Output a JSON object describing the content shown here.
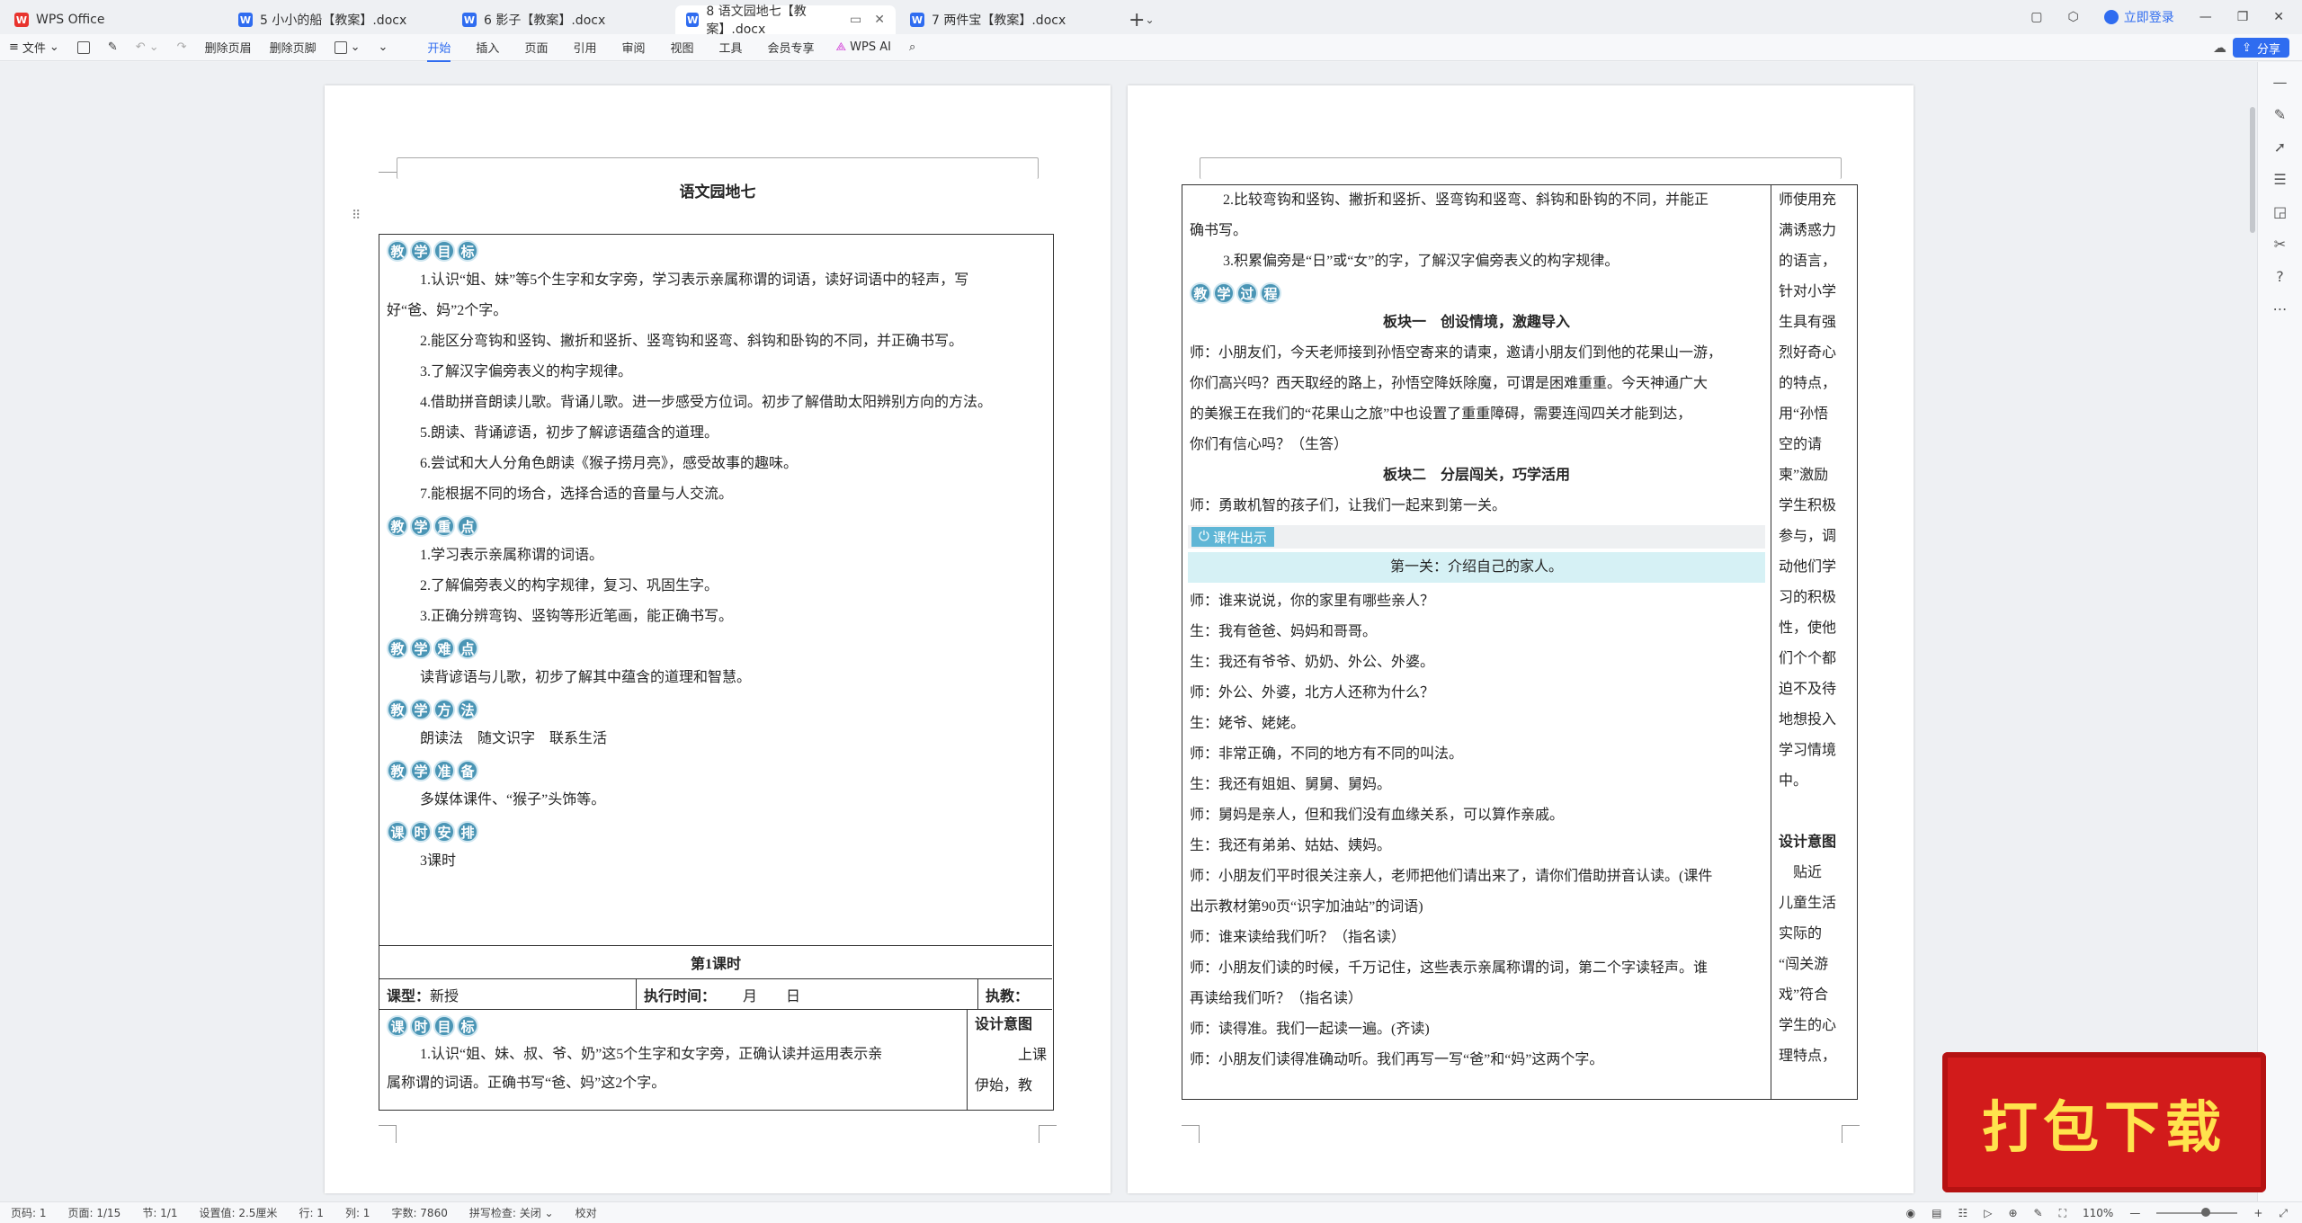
{
  "tabs": [
    {
      "label": "WPS Office",
      "type": "wps"
    },
    {
      "label": "5 小小的船【教案】.docx",
      "type": "doc"
    },
    {
      "label": "6 影子【教案】.docx",
      "type": "doc"
    },
    {
      "label": "8 语文园地七【教案】.docx",
      "type": "doc",
      "active": true
    },
    {
      "label": "7 两件宝【教案】.docx",
      "type": "doc"
    }
  ],
  "window": {
    "login": "立即登录",
    "share": "分享"
  },
  "ribbon": {
    "file": "文件",
    "delete_header": "删除页眉",
    "delete_footer": "删除页脚",
    "menus": [
      "开始",
      "插入",
      "页面",
      "引用",
      "审阅",
      "视图",
      "工具",
      "会员专享"
    ],
    "wps_ai": "WPS AI"
  },
  "page1": {
    "title": "语文园地七",
    "sections": [
      {
        "badge": [
          "教",
          "学",
          "目",
          "标"
        ],
        "lines": [
          "1.认识“姐、妹”等5个生字和女字旁，学习表示亲属称谓的词语，读好词语中的轻声，写",
          "好“爸、妈”2个字。",
          "2.能区分弯钩和竖钩、撇折和竖折、竖弯钩和竖弯、斜钩和卧钩的不同，并正确书写。",
          "3.了解汉字偏旁表义的构字规律。",
          "4.借助拼音朗读儿歌。背诵儿歌。进一步感受方位词。初步了解借助太阳辨别方向的方法。",
          "5.朗读、背诵谚语，初步了解谚语蕴含的道理。",
          "6.尝试和大人分角色朗读《猴子捞月亮》，感受故事的趣味。",
          "7.能根据不同的场合，选择合适的音量与人交流。"
        ]
      },
      {
        "badge": [
          "教",
          "学",
          "重",
          "点"
        ],
        "lines": [
          "1.学习表示亲属称谓的词语。",
          "2.了解偏旁表义的构字规律，复习、巩固生字。",
          "3.正确分辨弯钩、竖钩等形近笔画，能正确书写。"
        ]
      },
      {
        "badge": [
          "教",
          "学",
          "难",
          "点"
        ],
        "lines": [
          "读背谚语与儿歌，初步了解其中蕴含的道理和智慧。"
        ]
      },
      {
        "badge": [
          "教",
          "学",
          "方",
          "法"
        ],
        "lines": [
          "朗读法　随文识字　联系生活"
        ]
      },
      {
        "badge": [
          "教",
          "学",
          "准",
          "备"
        ],
        "lines": [
          "多媒体课件、“猴子”头饰等。"
        ]
      },
      {
        "badge": [
          "课",
          "时",
          "安",
          "排"
        ],
        "lines": [
          "3课时"
        ]
      }
    ],
    "lesson_title": "第1课时",
    "type_label": "课型：",
    "type_value": "新授",
    "time_label": "执行时间：",
    "time_value": "月　　日",
    "teacher_label": "执教：",
    "lesson_badge": [
      "课",
      "时",
      "目",
      "标"
    ],
    "lesson_goal": [
      "1.认识“姐、妹、叔、爷、奶”这5个生字和女字旁，正确认读并运用表示亲",
      "属称谓的词语。正确书写“爸、妈”这2个字。"
    ],
    "design_title": "设计意图",
    "design_lines": [
      "上课",
      "伊始，教"
    ]
  },
  "page2": {
    "main_lines": [
      "2.比较弯钩和竖钩、撇折和竖折、竖弯钩和竖弯、斜钩和卧钩的不同，并能正",
      "确书写。",
      "3.积累偏旁是“日”或“女”的字，了解汉字偏旁表义的构字规律。"
    ],
    "process_badge": [
      "教",
      "学",
      "过",
      "程"
    ],
    "block1_title": "板块一　创设情境，激趣导入",
    "block1_lines": [
      "师：小朋友们，今天老师接到孙悟空寄来的请柬，邀请小朋友们到他的花果山一游，",
      "你们高兴吗？西天取经的路上，孙悟空降妖除魔，可谓是困难重重。今天神通广大",
      "的美猴王在我们的“花果山之旅”中也设置了重重障碍，需要连闯四关才能到达，",
      "你们有信心吗？（生答）"
    ],
    "block2_title": "板块二　分层闯关，巧学活用",
    "block2_intro": "师：勇敢机智的孩子们，让我们一起来到第一关。",
    "courseware": "课件出示",
    "first_level": "第一关：介绍自己的家人。",
    "dialog": [
      "师：谁来说说，你的家里有哪些亲人？",
      "生：我有爸爸、妈妈和哥哥。",
      "生：我还有爷爷、奶奶、外公、外婆。",
      "师：外公、外婆，北方人还称为什么？",
      "生：姥爷、姥姥。",
      "师：非常正确，不同的地方有不同的叫法。",
      "生：我还有姐姐、舅舅、舅妈。",
      "师：舅妈是亲人，但和我们没有血缘关系，可以算作亲戚。",
      "生：我还有弟弟、姑姑、姨妈。",
      "师：小朋友们平时很关注亲人，老师把他们请出来了，请你们借助拼音认读。(课件",
      "出示教材第90页“识字加油站”的词语)",
      "师：谁来读给我们听？（指名读）",
      "师：小朋友们读的时候，千万记住，这些表示亲属称谓的词，第二个字读轻声。谁",
      "再读给我们听？（指名读）",
      "师：读得准。我们一起读一遍。(齐读)",
      "师：小朋友们读得准确动听。我们再写一写“爸”和“妈”这两个字。"
    ],
    "side_lines": [
      "师使用充",
      "满诱惑力",
      "的语言，",
      "针对小学",
      "生具有强",
      "烈好奇心",
      "的特点，",
      "用“孙悟",
      "空的请",
      "柬”激励",
      "学生积极",
      "参与，调",
      "动他们学",
      "习的积极",
      "性，使他",
      "们个个都",
      "迫不及待",
      "地想投入",
      "学习情境",
      "中。"
    ],
    "side_design_title": "设计意图",
    "side_design_lines": [
      "　贴近",
      "儿童生活",
      "实际的",
      "“闯关游",
      "戏”符合",
      "学生的心",
      "理特点，"
    ]
  },
  "status": {
    "page_no": "页码: 1",
    "pages": "页面: 1/15",
    "section": "节: 1/1",
    "setting": "设置值: 2.5厘米",
    "row": "行: 1",
    "col": "列: 1",
    "words": "字数: 7860",
    "spell": "拼写检查: 关闭",
    "proof": "校对",
    "zoom": "110%"
  },
  "banner": {
    "text": "打包下载"
  }
}
